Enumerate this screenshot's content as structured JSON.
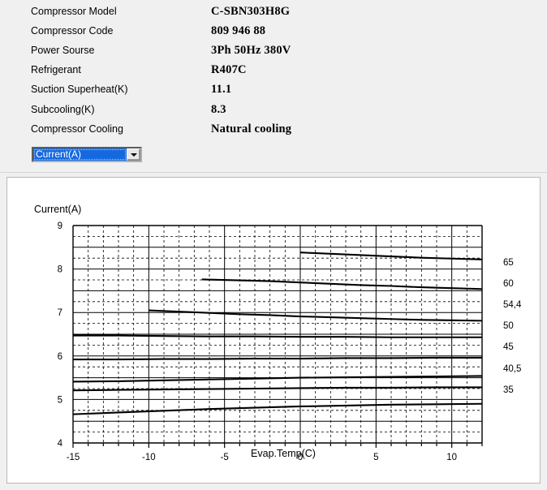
{
  "specs": {
    "rows": [
      {
        "label": "Compressor  Model",
        "value": "C-SBN303H8G"
      },
      {
        "label": "Compressor Code",
        "value": "809 946 88"
      },
      {
        "label": "Power Sourse",
        "value": "3Ph  50Hz  380V"
      },
      {
        "label": "Refrigerant",
        "value": "R407C"
      },
      {
        "label": "Suction Superheat(K)",
        "value": "11.1"
      },
      {
        "label": "Subcooling(K)",
        "value": "8.3"
      },
      {
        "label": "Compressor Cooling",
        "value": "Natural cooling"
      }
    ]
  },
  "unit_select": {
    "value": "Current(A)",
    "arrow_icon": "chevron-down-icon"
  },
  "chart_data": {
    "type": "line",
    "title": "Current(A)",
    "xlabel": "Evap.Temp(C)",
    "ylabel": "Current(A)",
    "xlim": [
      -15,
      12
    ],
    "ylim": [
      4,
      9
    ],
    "xticks": [
      -15,
      -10,
      -5,
      0,
      5,
      10
    ],
    "yticks": [
      4,
      5,
      6,
      7,
      8,
      9
    ],
    "grid": true,
    "legend_position": "right-of-axes",
    "series": [
      {
        "name": "65",
        "label": "65",
        "x": [
          0,
          2,
          4,
          6,
          8,
          10,
          12
        ],
        "y": [
          8.38,
          8.35,
          8.32,
          8.29,
          8.26,
          8.24,
          8.22
        ]
      },
      {
        "name": "60",
        "label": "60",
        "x": [
          -6.5,
          -4,
          -2,
          0,
          2,
          4,
          6,
          8,
          10,
          12
        ],
        "y": [
          7.76,
          7.74,
          7.72,
          7.69,
          7.66,
          7.63,
          7.61,
          7.58,
          7.56,
          7.54
        ]
      },
      {
        "name": "54,4",
        "label": "54,4",
        "x": [
          -10,
          -8,
          -6,
          -4,
          -2,
          0,
          2,
          4,
          6,
          8,
          10,
          12
        ],
        "y": [
          7.05,
          7.02,
          6.99,
          6.96,
          6.94,
          6.91,
          6.89,
          6.87,
          6.85,
          6.83,
          6.82,
          6.81
        ]
      },
      {
        "name": "50",
        "label": "50",
        "x": [
          -15,
          -12,
          -9,
          -6,
          -3,
          0,
          3,
          6,
          9,
          12
        ],
        "y": [
          6.47,
          6.47,
          6.46,
          6.45,
          6.45,
          6.44,
          6.44,
          6.43,
          6.43,
          6.43
        ]
      },
      {
        "name": "45",
        "label": "45",
        "x": [
          -15,
          -12,
          -9,
          -6,
          -3,
          0,
          3,
          6,
          9,
          12
        ],
        "y": [
          5.92,
          5.92,
          5.93,
          5.93,
          5.94,
          5.94,
          5.95,
          5.95,
          5.96,
          5.96
        ]
      },
      {
        "name": "40,5",
        "label": "40,5",
        "x": [
          -15,
          -12,
          -9,
          -6,
          -3,
          0,
          3,
          6,
          9,
          12
        ],
        "y": [
          5.41,
          5.42,
          5.44,
          5.46,
          5.48,
          5.5,
          5.51,
          5.52,
          5.53,
          5.54
        ]
      },
      {
        "name": "35",
        "label": "35",
        "x": [
          -15,
          -12,
          -9,
          -6,
          -3,
          0,
          3,
          6,
          9,
          12
        ],
        "y": [
          5.21,
          5.22,
          5.23,
          5.24,
          5.25,
          5.26,
          5.27,
          5.27,
          5.28,
          5.28
        ]
      },
      {
        "name": "lower-1",
        "label": "",
        "x": [
          -15,
          -12,
          -9,
          -6,
          -3,
          0,
          3,
          6,
          9,
          12
        ],
        "y": [
          4.66,
          4.7,
          4.74,
          4.78,
          4.81,
          4.84,
          4.86,
          4.88,
          4.89,
          4.9
        ]
      }
    ],
    "right_labels": [
      "65",
      "60",
      "54,4",
      "50",
      "45",
      "40,5",
      "35"
    ]
  }
}
